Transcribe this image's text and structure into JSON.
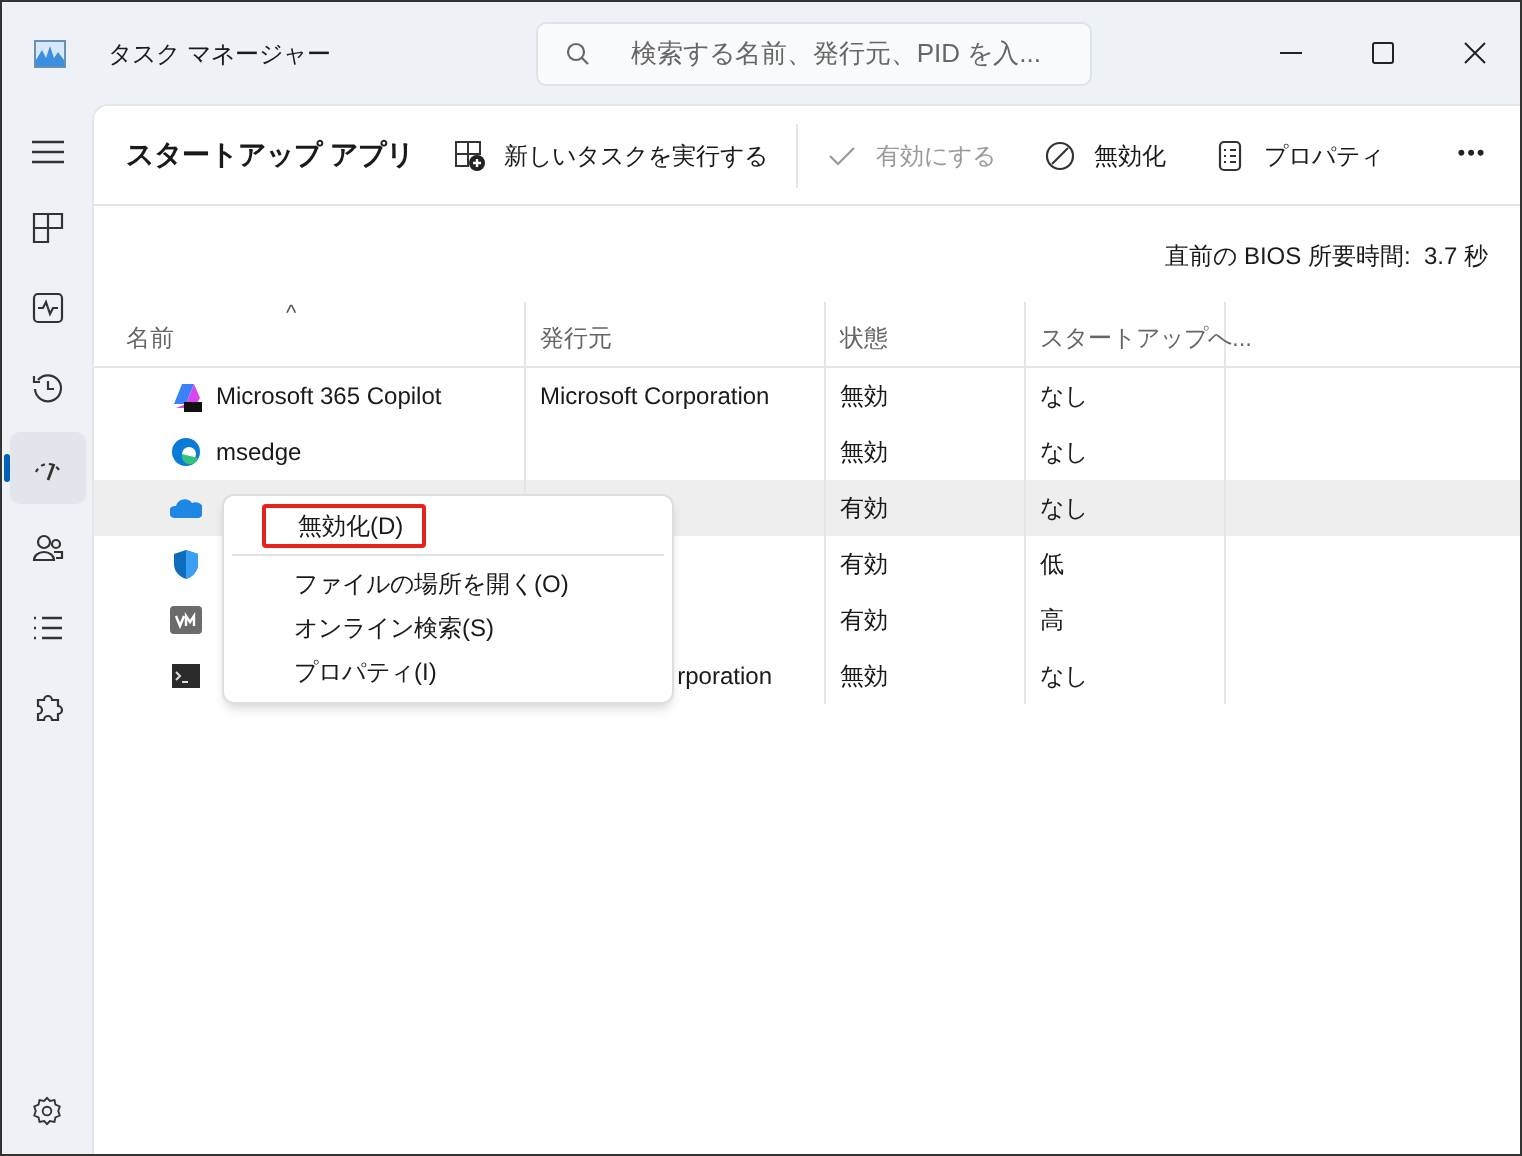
{
  "window": {
    "title": "タスク マネージャー"
  },
  "search": {
    "placeholder": "検索する名前、発行元、PID を入..."
  },
  "sidebar": {
    "items": [
      {
        "kind": "processes",
        "selected": false
      },
      {
        "kind": "performance",
        "selected": false
      },
      {
        "kind": "history",
        "selected": false
      },
      {
        "kind": "startup",
        "selected": true
      },
      {
        "kind": "users",
        "selected": false
      },
      {
        "kind": "details",
        "selected": false
      },
      {
        "kind": "services",
        "selected": false
      }
    ]
  },
  "page_title": "スタートアップ アプリ",
  "toolbar": [
    {
      "kind": "new-task",
      "label": "新しいタスクを実行する",
      "disabled": false
    },
    {
      "kind": "enable",
      "label": "有効にする",
      "disabled": true
    },
    {
      "kind": "disable",
      "label": "無効化",
      "disabled": false
    },
    {
      "kind": "properties",
      "label": "プロパティ",
      "disabled": false
    },
    {
      "kind": "more",
      "label": "•••",
      "disabled": false
    }
  ],
  "bios_time": "直前の BIOS 所要時間:  3.7 秒",
  "table": {
    "sort_mark": "^",
    "columns": [
      "名前",
      "発行元",
      "状態",
      "スタートアップへ..."
    ],
    "rows": [
      {
        "kind": "copilot",
        "name": "Microsoft 365 Copilot",
        "publisher": "Microsoft Corporation",
        "status": "無効",
        "impact": "なし",
        "hovered": false
      },
      {
        "kind": "edge",
        "name": "msedge",
        "status": "無効",
        "impact": "なし",
        "hovered": false
      },
      {
        "kind": "cloud",
        "status": "有効",
        "impact": "なし",
        "hovered": true
      },
      {
        "kind": "shield",
        "status": "有効",
        "impact": "低",
        "hovered": false
      },
      {
        "kind": "vm",
        "status": "有効",
        "impact": "高",
        "hovered": false
      },
      {
        "kind": "terminal",
        "publisher": "rporation",
        "publisher_cut": true,
        "status": "無効",
        "impact": "なし",
        "hovered": false
      }
    ]
  },
  "context_menu": {
    "items": [
      {
        "label": "無効化(D)",
        "highlighted": true
      },
      {
        "label": "ファイルの場所を開く(O)",
        "highlighted": false
      },
      {
        "label": "オンライン検索(S)",
        "highlighted": false
      },
      {
        "label": "プロパティ(I)",
        "highlighted": false
      }
    ]
  }
}
